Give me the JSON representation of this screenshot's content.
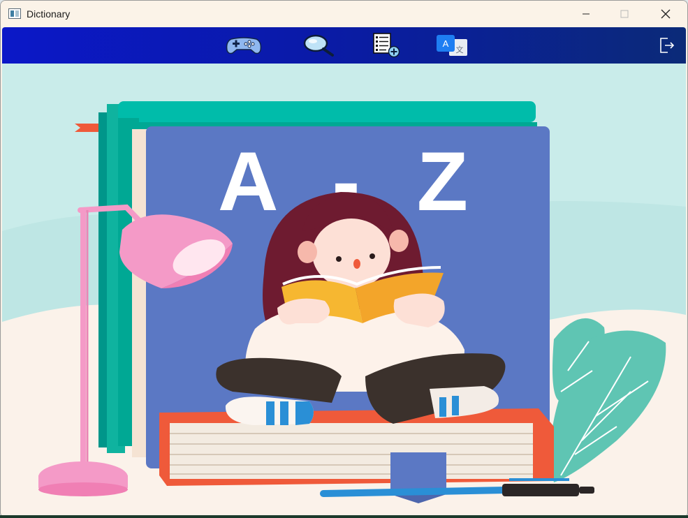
{
  "window": {
    "title": "Dictionary",
    "controls": {
      "minimize_icon": "minimize-icon",
      "maximize_icon": "maximize-icon",
      "close_icon": "close-icon"
    }
  },
  "toolbar": {
    "tools": [
      {
        "id": "game",
        "icon": "gamepad-icon"
      },
      {
        "id": "search",
        "icon": "magnifier-icon"
      },
      {
        "id": "wordlist",
        "icon": "add-to-list-icon"
      },
      {
        "id": "translate",
        "icon": "translate-icon"
      }
    ],
    "exit_icon": "logout-icon",
    "glyphs": {
      "translate_latin": "A",
      "translate_cjk": "文"
    },
    "colors": {
      "gradient_start": "#0b18c8",
      "gradient_end": "#0b2a78"
    }
  },
  "illustration": {
    "book_cover_text": "A - Z",
    "left_letter": "A",
    "dash": "-",
    "right_letter": "Z",
    "colors": {
      "sky": "#c9ecea",
      "ground": "#fbf2ea",
      "book_blue": "#5b78c4",
      "book_teal": "#00b8a6",
      "lamp_pink": "#f49ac7",
      "base_book_red": "#ef5a3a",
      "hair": "#6e1b30",
      "open_book": "#f6b731",
      "pants": "#3b312c",
      "leaf": "#5fc5b3",
      "pen": "#2a8fd6"
    }
  }
}
